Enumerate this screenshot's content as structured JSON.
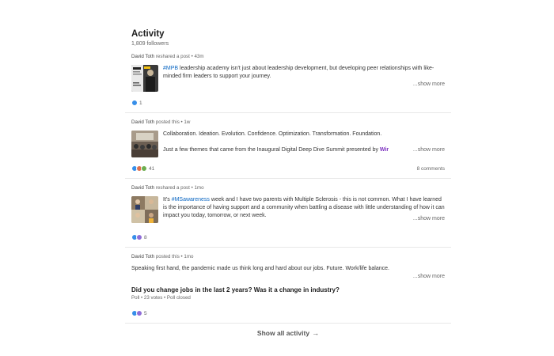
{
  "activity": {
    "title": "Activity",
    "followers": "1,809 followers",
    "show_all": "Show all activity",
    "show_all_arrow": "→"
  },
  "posts": [
    {
      "author": "David Toth",
      "action": "reshared a post",
      "time": "43m",
      "hashtag": "#MPB",
      "text": "leadership academy isn't just about leadership development, but developing peer relationships with like-minded firm leaders to support your journey.",
      "show_more": "...show more",
      "reaction_count": "1"
    },
    {
      "author": "David Toth",
      "action": "posted this",
      "time": "1w",
      "line1": "Collaboration. Ideation. Evolution. Confidence. Optimization. Transformation. Foundation.",
      "line2": "Just a few themes that came from the Inaugural Digital Deep Dive Summit presented by",
      "mention": "Wir",
      "show_more": "...show more",
      "reaction_count": "41",
      "comments": "8 comments"
    },
    {
      "author": "David Toth",
      "action": "reshared a post",
      "time": "1mo",
      "prefix": "It's",
      "hashtag": "#MSawareness",
      "text": "week and I have two parents with Multiple Sclerosis - this is not common. What I have learned is the importance of having support and a community when battling a disease with little understanding of how it can impact you today, tomorrow, or next week.",
      "show_more": "...show more",
      "reaction_count": "8"
    },
    {
      "author": "David Toth",
      "action": "posted this",
      "time": "1mo",
      "text": "Speaking first hand, the pandemic made us think long and hard about our jobs. Future. Work/life balance.",
      "show_more": "...show more",
      "poll_question": "Did you change jobs in the last 2 years? Was it a change in industry?",
      "poll_meta": "Poll • 23 votes • Poll closed",
      "reaction_count": "5"
    }
  ]
}
